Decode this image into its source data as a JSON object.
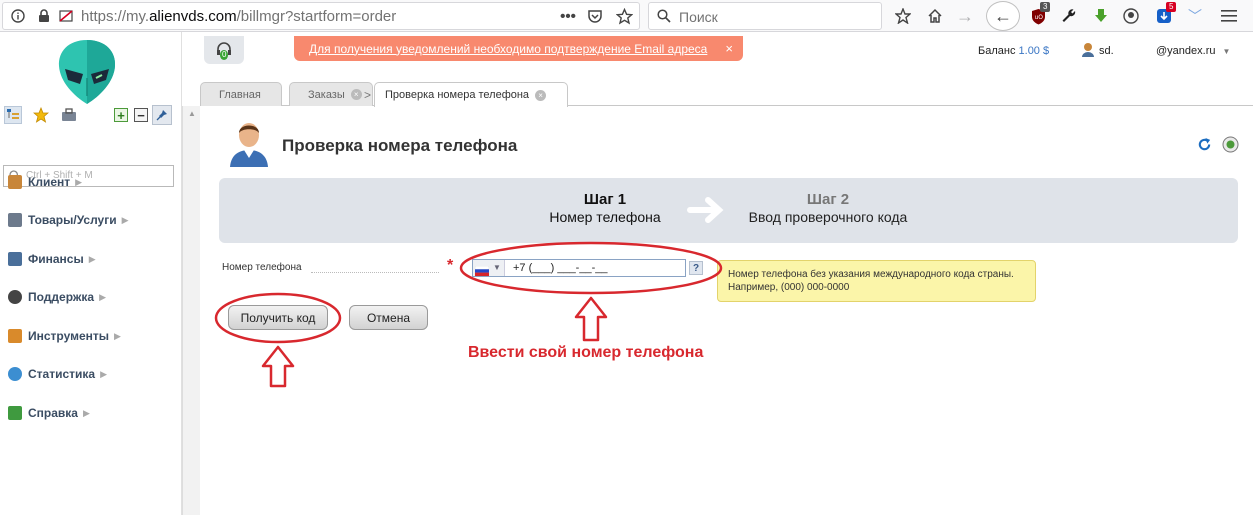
{
  "browser": {
    "url_prefix": "https://my.",
    "url_domain": "alienvds.com",
    "url_path": "/billmgr?startform=order",
    "search_placeholder": "Поиск",
    "ublock_badge": "3",
    "download_badge": "5"
  },
  "notice": {
    "text": "Для получения уведомлений необходимо подтверждение Email адреса",
    "close": "×"
  },
  "support_badge": "0",
  "account": {
    "balance_label": "Баланс",
    "balance_value": "1.00 $",
    "user": "sd.",
    "email": "@yandex.ru"
  },
  "sidebar": {
    "search_placeholder": "Ctrl + Shift + M",
    "items": [
      {
        "label": "Клиент",
        "color": "#c8863a"
      },
      {
        "label": "Товары/Услуги",
        "color": "#6d7a8c"
      },
      {
        "label": "Финансы",
        "color": "#4a6f9a"
      },
      {
        "label": "Поддержка",
        "color": "#444444"
      },
      {
        "label": "Инструменты",
        "color": "#d98a2b"
      },
      {
        "label": "Статистика",
        "color": "#3c8ed1"
      },
      {
        "label": "Справка",
        "color": "#3f9a3f"
      }
    ]
  },
  "tabs": [
    {
      "label": "Главная"
    },
    {
      "label": "Заказы"
    },
    {
      "label": "Проверка номера телефона"
    }
  ],
  "page": {
    "title": "Проверка номера телефона"
  },
  "steps": [
    {
      "num": "Шаг 1",
      "name": "Номер телефона"
    },
    {
      "num": "Шаг 2",
      "name": "Ввод проверочного кода"
    }
  ],
  "form": {
    "phone_label": "Номер телефона",
    "required_mark": "*",
    "phone_value": "+7 (___) ___-__-__",
    "help_mark": "?",
    "hint": "Номер телефона без указания международного кода страны. Например, (000) 000-0000",
    "submit_label": "Получить код",
    "cancel_label": "Отмена"
  },
  "annotation": "Ввести свой номер телефона",
  "colors": {
    "accent": "#3b4d63",
    "notice": "#f8896e",
    "annotation": "#d8282e",
    "link": "#3a76c4"
  }
}
